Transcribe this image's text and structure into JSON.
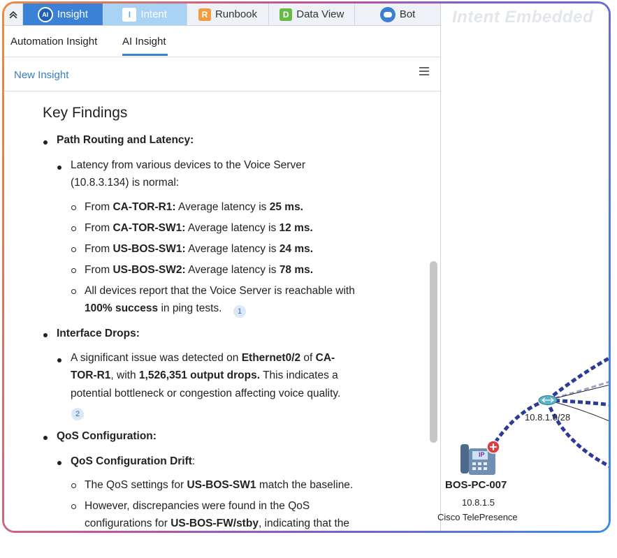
{
  "tabs": {
    "insight": "Insight",
    "intent": "Intent",
    "runbook": "Runbook",
    "data_view": "Data View",
    "bot": "Bot"
  },
  "subtabs": {
    "automation": "Automation Insight",
    "ai": "AI Insight"
  },
  "toolbar": {
    "new_insight": "New Insight"
  },
  "findings": {
    "heading": "Key Findings",
    "path": {
      "title": "Path Routing and Latency:",
      "intro_1": "Latency from various devices to the Voice Server",
      "intro_2": "(10.8.3.134) is normal:",
      "items": [
        {
          "pre": "From ",
          "dev": "CA-TOR-R1:",
          "mid": " Average latency is ",
          "val": "25 ms."
        },
        {
          "pre": "From ",
          "dev": "CA-TOR-SW1:",
          "mid": " Average latency is ",
          "val": "12 ms."
        },
        {
          "pre": "From ",
          "dev": "US-BOS-SW1:",
          "mid": " Average latency is ",
          "val": "24 ms."
        },
        {
          "pre": "From ",
          "dev": "US-BOS-SW2:",
          "mid": " Average latency is ",
          "val": "78 ms."
        }
      ],
      "reach_1": "All devices report that the Voice Server is reachable with",
      "reach_2_bold": "100% success",
      "reach_2_rest": " in ping tests.",
      "cite": "1"
    },
    "drops": {
      "title": "Interface Drops:",
      "l1_pre": "A significant issue was detected on ",
      "l1_if": "Ethernet0/2",
      "l1_mid": " of ",
      "l1_dev": "CA-",
      "l2_dev": "TOR-R1",
      "l2_mid": ", with ",
      "l2_val": "1,526,351 output drops.",
      "l2_rest": " This indicates a",
      "l3": "potential bottleneck or congestion affecting voice quality.",
      "cite": "2"
    },
    "qos": {
      "title": "QoS Configuration:",
      "drift_title": "QoS Configuration Drift",
      "drift_colon": ":",
      "m1_pre": "The QoS settings for ",
      "m1_dev": "US-BOS-SW1",
      "m1_rest": " match the baseline.",
      "m2_l1": "However, discrepancies were found in the QoS",
      "m2_l2_pre": "configurations for ",
      "m2_l2_dev": "US-BOS-FW/stby",
      "m2_l2_rest": ", indicating that the"
    }
  },
  "map": {
    "watermark": "Intent Embedded",
    "subnet": "10.8.1.0/28",
    "node": {
      "name": "BOS-PC-007",
      "ip": "10.8.1.5",
      "type": "Cisco TelePresence"
    },
    "phone_badge": "IP"
  },
  "colors": {
    "tab_active": "#3b82d6",
    "tab_intent": "#a9d3f5",
    "link": "#3b7bc7",
    "path_dashed": "#2c3a9a"
  }
}
